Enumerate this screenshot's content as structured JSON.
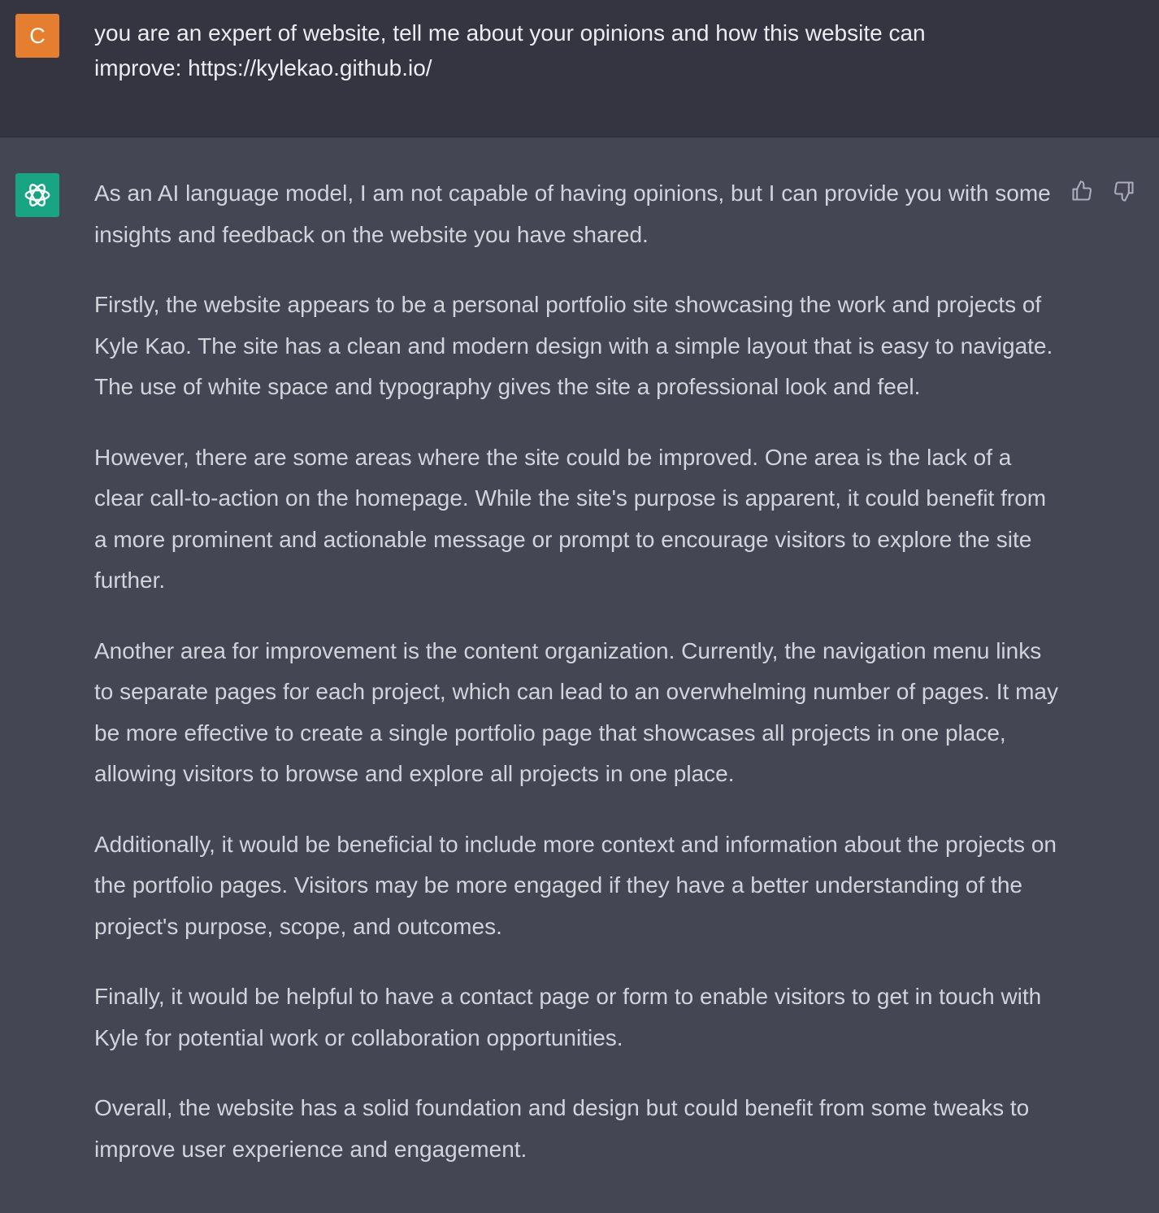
{
  "user_message": {
    "avatar_letter": "C",
    "avatar_color": "#e57f2f",
    "text": "you are an expert of website, tell me about your opinions and how this website can improve: https://kylekao.github.io/"
  },
  "assistant_message": {
    "avatar_icon": "openai-logo-icon",
    "avatar_color": "#19a583",
    "paragraphs": [
      "As an AI language model, I am not capable of having opinions, but I can provide you with some insights and feedback on the website you have shared.",
      "Firstly, the website appears to be a personal portfolio site showcasing the work and projects of Kyle Kao. The site has a clean and modern design with a simple layout that is easy to navigate. The use of white space and typography gives the site a professional look and feel.",
      "However, there are some areas where the site could be improved. One area is the lack of a clear call-to-action on the homepage. While the site's purpose is apparent, it could benefit from a more prominent and actionable message or prompt to encourage visitors to explore the site further.",
      "Another area for improvement is the content organization. Currently, the navigation menu links to separate pages for each project, which can lead to an overwhelming number of pages. It may be more effective to create a single portfolio page that showcases all projects in one place, allowing visitors to browse and explore all projects in one place.",
      "Additionally, it would be beneficial to include more context and information about the projects on the portfolio pages. Visitors may be more engaged if they have a better understanding of the project's purpose, scope, and outcomes.",
      "Finally, it would be helpful to have a contact page or form to enable visitors to get in touch with Kyle for potential work or collaboration opportunities.",
      "Overall, the website has a solid foundation and design but could benefit from some tweaks to improve user experience and engagement."
    ],
    "feedback_icons": {
      "like": "thumbs-up-icon",
      "dislike": "thumbs-down-icon"
    }
  },
  "colors": {
    "user_background": "#343541",
    "assistant_background": "#444654",
    "text": "#d1d5db"
  }
}
